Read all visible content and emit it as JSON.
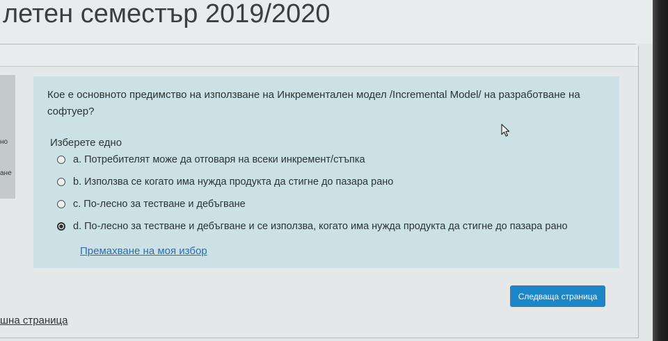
{
  "page": {
    "title": "летен семестър 2019/2020"
  },
  "info_panel": {
    "fragments": [
      "но",
      "ане"
    ]
  },
  "question": {
    "text": "Кое е основното предимство на използване на Инкрементален модел /Incremental Model/ на разработване на софтуер?",
    "prompt": "Изберете едно",
    "options": [
      {
        "label": "a. Потребителят може да отговаря на всеки инкремент/стъпка",
        "selected": false
      },
      {
        "label": "b. Използва се когато има нужда продукта да стигне до пазара рано",
        "selected": false
      },
      {
        "label": "c. По-лесно за тестване и дебъгване",
        "selected": false
      },
      {
        "label": "d. По-лесно за тестване и дебъгване и се използва, когато има нужда продукта да стигне до пазара рано",
        "selected": true
      }
    ],
    "clear_choice_label": "Премахване на моя избор"
  },
  "navigation": {
    "next_page_label": "Следваща страница",
    "previous_page_label": "шна страница"
  },
  "icons": {
    "pointer": "mouse-pointer-icon"
  },
  "colors": {
    "page_bg": "#e2e5e6",
    "question_bg": "#cce1e5",
    "link": "#2a6db3",
    "button_bg": "#1c86c9",
    "button_text": "#ffffff"
  }
}
